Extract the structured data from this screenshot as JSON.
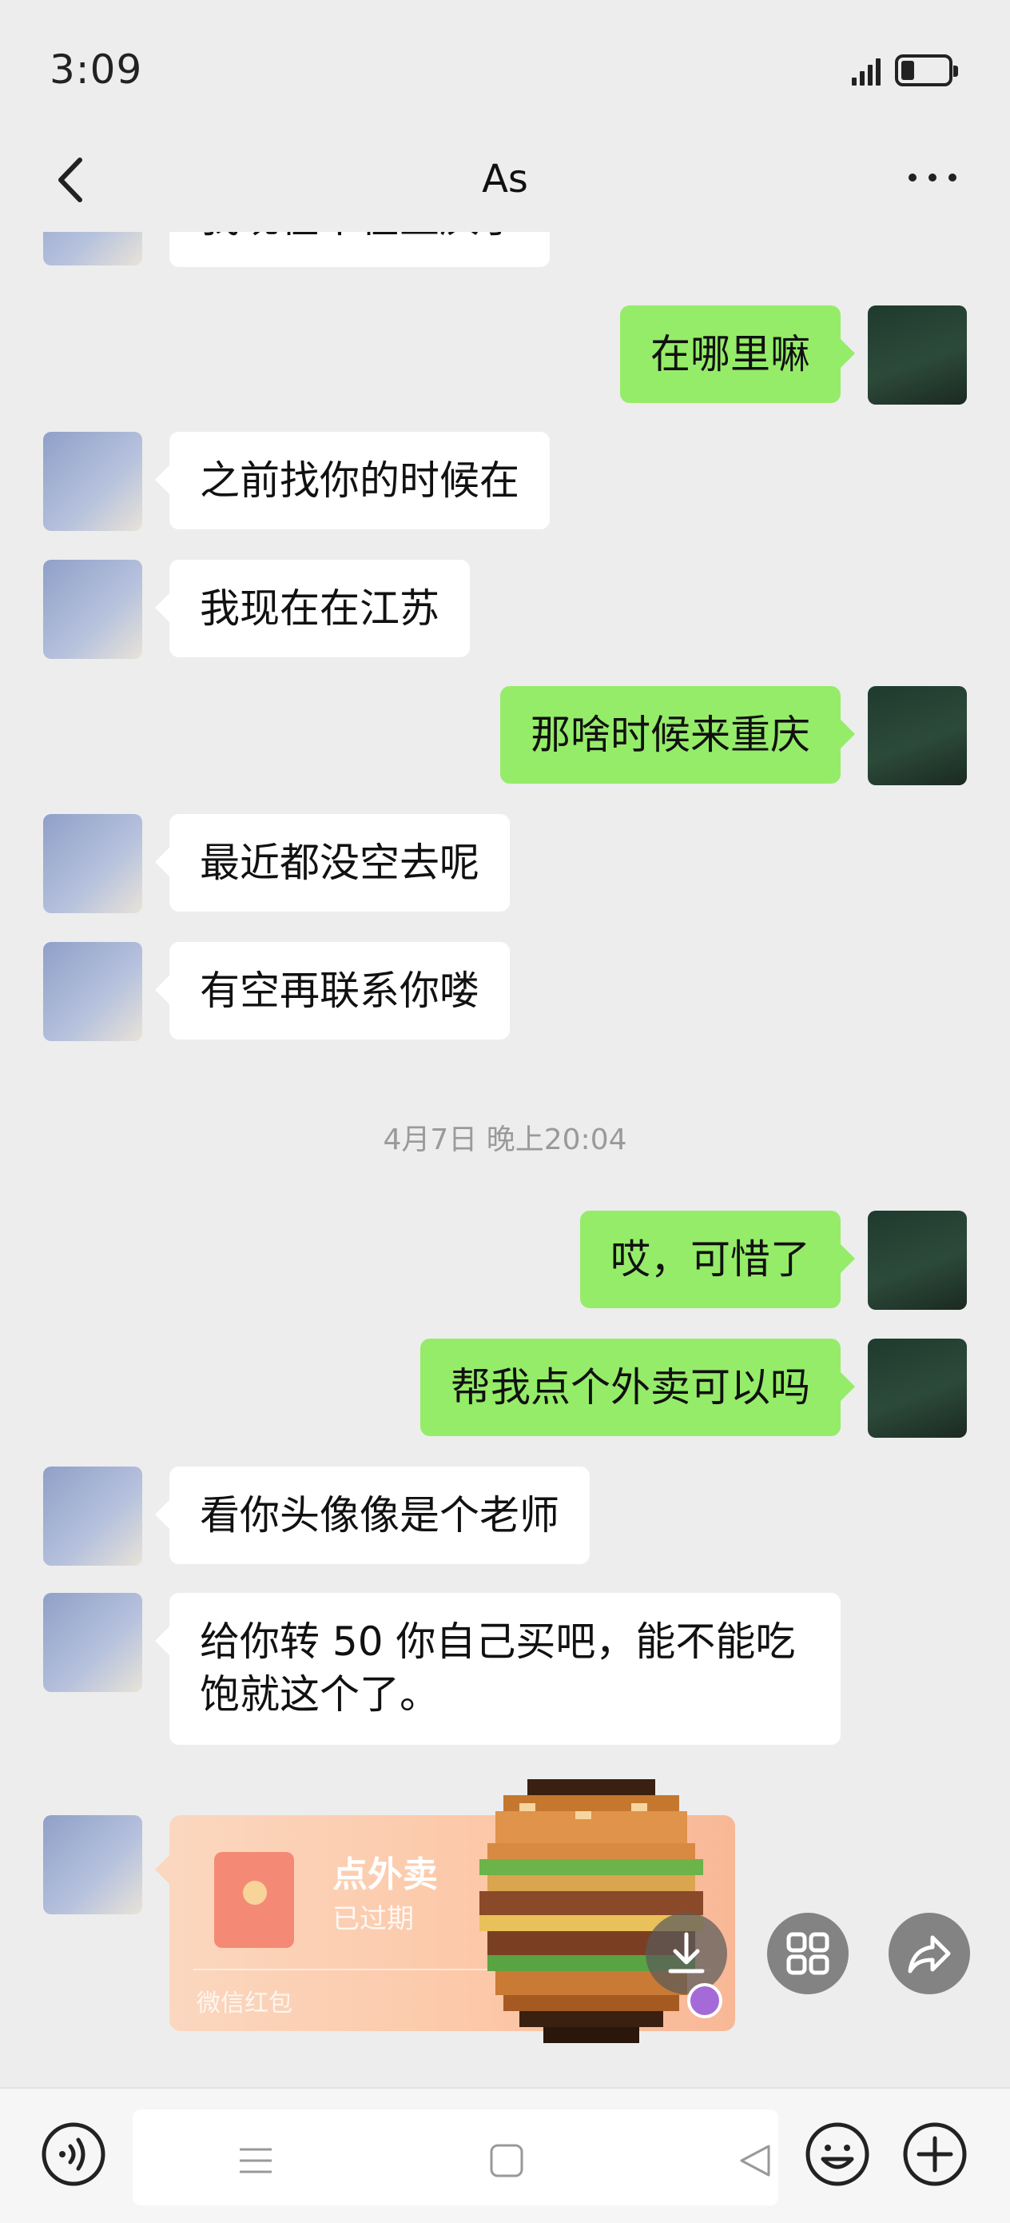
{
  "status_bar": {
    "time": "3:09",
    "signal_bars": 4,
    "battery_level": 0.28
  },
  "header": {
    "title": "As",
    "back_icon": "chevron-left-icon",
    "more_icon": "ellipsis-icon"
  },
  "messages": [
    {
      "from": "them",
      "text": "我现在不在重庆了"
    },
    {
      "from": "me",
      "text": "在哪里嘛"
    },
    {
      "from": "them",
      "text": "之前找你的时候在"
    },
    {
      "from": "them",
      "text": "我现在在江苏"
    },
    {
      "from": "me",
      "text": "那啥时候来重庆"
    },
    {
      "from": "them",
      "text": "最近都没空去呢"
    },
    {
      "from": "them",
      "text": "有空再联系你喽"
    },
    {
      "from": "me",
      "text": "哎，可惜了"
    },
    {
      "from": "me",
      "text": "帮我点个外卖可以吗"
    },
    {
      "from": "them",
      "text": "看你头像像是个老师"
    },
    {
      "from": "them",
      "text": "给你转 50 你自己买吧，能不能吃饱就这个了。"
    }
  ],
  "timestamp": "4月7日 晚上20:04",
  "red_packet": {
    "title": "点外卖",
    "status": "已过期",
    "footer": "微信红包"
  },
  "overlay_buttons": [
    "download-icon",
    "grid-icon",
    "share-icon"
  ],
  "input_bar": {
    "left_icon": "voice-icon",
    "right_icons": [
      "emoji-icon",
      "plus-icon"
    ]
  },
  "colors": {
    "background": "#ededed",
    "my_bubble": "#95ec69",
    "their_bubble": "#ffffff"
  }
}
